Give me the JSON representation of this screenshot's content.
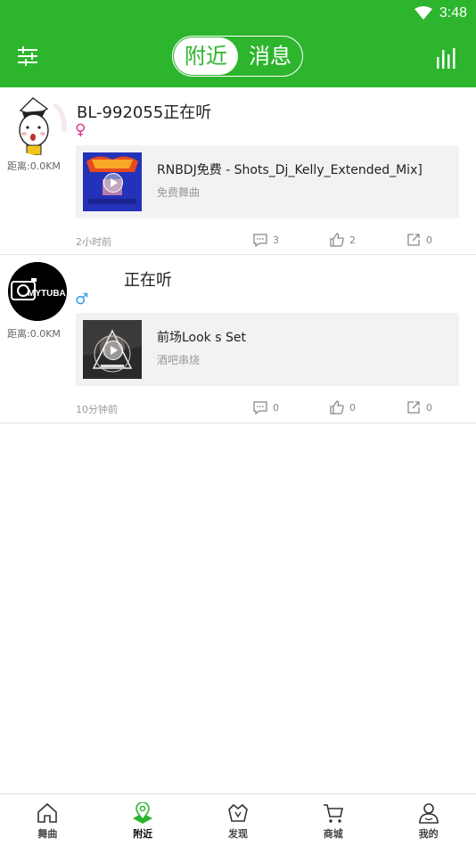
{
  "status_bar": {
    "time": "3:48"
  },
  "header": {
    "tabs": [
      {
        "label": "附近",
        "active": true
      },
      {
        "label": "消息",
        "active": false
      }
    ],
    "accent_color": "#2db52d"
  },
  "feed": [
    {
      "username": "BL-992055正在听",
      "gender": "♀",
      "distance": "距离:0.0KM",
      "song": {
        "title": "RNBDJ免费 - Shots_Dj_Kelly_Extended_Mix]",
        "category": "免费舞曲"
      },
      "time": "2小时前",
      "comments": "3",
      "likes": "2",
      "shares": "0"
    },
    {
      "username": "正在听",
      "gender": "♂",
      "distance": "距离:0.0KM",
      "avatar_text": "MYTUBA",
      "song": {
        "title": "前场Look s Set",
        "category": "酒吧串烧"
      },
      "time": "10分钟前",
      "comments": "0",
      "likes": "0",
      "shares": "0"
    }
  ],
  "bottom_nav": [
    {
      "label": "舞曲",
      "icon": "home-icon"
    },
    {
      "label": "附近",
      "icon": "location-icon",
      "active": true
    },
    {
      "label": "发现",
      "icon": "discover-icon"
    },
    {
      "label": "商城",
      "icon": "cart-icon"
    },
    {
      "label": "我的",
      "icon": "profile-icon"
    }
  ]
}
